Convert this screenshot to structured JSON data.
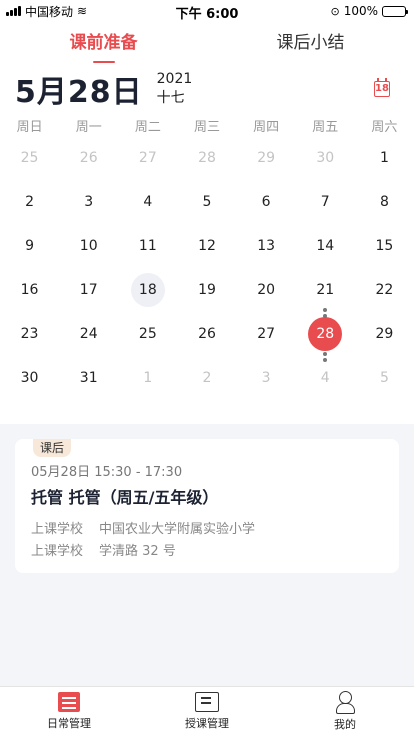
{
  "status_bar": {
    "carrier": "中国移动",
    "time": "下午 6:00",
    "battery_pct": "100%",
    "battery_level": 1.0
  },
  "tabs": [
    {
      "label": "课前准备",
      "active": true
    },
    {
      "label": "课后小结",
      "active": false
    }
  ],
  "date_header": {
    "big_date": "5月28日",
    "year": "2021",
    "lunar": "十七",
    "calendar_icon_text": "18"
  },
  "weekdays": [
    "周日",
    "周一",
    "周二",
    "周三",
    "周四",
    "周五",
    "周六"
  ],
  "calendar": {
    "weeks": [
      [
        {
          "d": "25",
          "muted": true
        },
        {
          "d": "26",
          "muted": true
        },
        {
          "d": "27",
          "muted": true
        },
        {
          "d": "28",
          "muted": true
        },
        {
          "d": "29",
          "muted": true
        },
        {
          "d": "30",
          "muted": true
        },
        {
          "d": "1"
        }
      ],
      [
        {
          "d": "2"
        },
        {
          "d": "3"
        },
        {
          "d": "4"
        },
        {
          "d": "5"
        },
        {
          "d": "6"
        },
        {
          "d": "7"
        },
        {
          "d": "8"
        }
      ],
      [
        {
          "d": "9"
        },
        {
          "d": "10"
        },
        {
          "d": "11"
        },
        {
          "d": "12"
        },
        {
          "d": "13"
        },
        {
          "d": "14"
        },
        {
          "d": "15"
        }
      ],
      [
        {
          "d": "16"
        },
        {
          "d": "17"
        },
        {
          "d": "18",
          "today": true
        },
        {
          "d": "19"
        },
        {
          "d": "20"
        },
        {
          "d": "21",
          "dot": "bottom"
        },
        {
          "d": "22"
        }
      ],
      [
        {
          "d": "23"
        },
        {
          "d": "24"
        },
        {
          "d": "25"
        },
        {
          "d": "26"
        },
        {
          "d": "27"
        },
        {
          "d": "28",
          "selected": true,
          "dot": "both"
        },
        {
          "d": "29"
        }
      ],
      [
        {
          "d": "30"
        },
        {
          "d": "31"
        },
        {
          "d": "1",
          "muted": true
        },
        {
          "d": "2",
          "muted": true
        },
        {
          "d": "3",
          "muted": true
        },
        {
          "d": "4",
          "muted": true,
          "dot": "top"
        },
        {
          "d": "5",
          "muted": true
        }
      ]
    ]
  },
  "card": {
    "badge": "课后",
    "time": "05月28日 15:30 - 17:30",
    "title": "托管 托管（周五/五年级）",
    "rows": [
      {
        "label": "上课学校",
        "value": "中国农业大学附属实验小学"
      },
      {
        "label": "上课学校",
        "value": "学清路 32 号"
      }
    ]
  },
  "tabbar": [
    {
      "label": "日常管理",
      "icon": "daily-management-icon"
    },
    {
      "label": "授课管理",
      "icon": "class-management-icon"
    },
    {
      "label": "我的",
      "icon": "profile-icon"
    }
  ],
  "colors": {
    "accent": "#e84c4f",
    "badge_bg": "#f7e8da"
  }
}
